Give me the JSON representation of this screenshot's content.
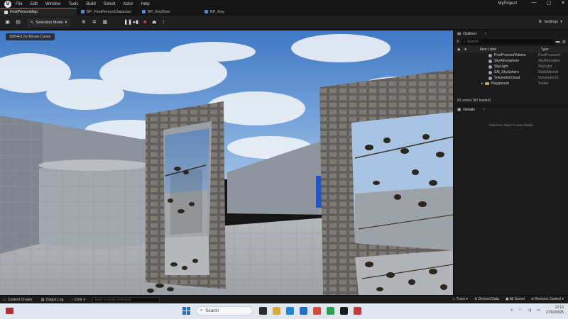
{
  "menubar": {
    "logo": "ue-logo",
    "items": [
      "File",
      "Edit",
      "Window",
      "Tools",
      "Build",
      "Select",
      "Actor",
      "Help"
    ],
    "project": "MyProject",
    "window_controls": [
      "—",
      "▢",
      "✕"
    ]
  },
  "tabs": [
    {
      "label": "FirstPersonMap",
      "active": true
    },
    {
      "label": "BP_FirstPersonCharacter",
      "active": false
    },
    {
      "label": "BP_KeyDoor",
      "active": false
    },
    {
      "label": "BP_Key",
      "active": false
    }
  ],
  "toolbar": {
    "mode_label": "Selection Mode",
    "settings_label": "Settings"
  },
  "viewport": {
    "hint": "Shift+F1 for Mouse Cursor"
  },
  "outliner": {
    "title": "Outliner",
    "search_placeholder": "Search...",
    "col_label": "Item Label",
    "col_type": "Type",
    "rows": [
      {
        "name": "PostProcessVolume",
        "type": "PostProcessV"
      },
      {
        "name": "SkyAtmosphere",
        "type": "SkyAtmosphe"
      },
      {
        "name": "SkyLight",
        "type": "SkyLight"
      },
      {
        "name": "SM_SkySphere",
        "type": "StaticMeshA"
      },
      {
        "name": "VolumetricCloud",
        "type": "VolumetricCl"
      }
    ],
    "folder_row": {
      "name": "Playground",
      "type": "Folder"
    },
    "actors_count": "82 actors (82 loaded)"
  },
  "details": {
    "title": "Details",
    "empty_message": "Select an object to view details."
  },
  "bottombar": {
    "content_drawer": "Content Drawer",
    "output_log": "Output Log",
    "cmd": "Cmd",
    "console_placeholder": "Enter Console Command",
    "trace": "Trace",
    "derived_data": "Derived Data",
    "all_saved": "All Saved",
    "revision_control": "Revision Control"
  },
  "taskbar": {
    "search_label": "Search",
    "time": "12:10",
    "date": "27/02/2025",
    "app_colors": [
      "#2c2c2c",
      "#d9a93b",
      "#1e88d6",
      "#1e6fd1",
      "#d84a3a",
      "#2a9d57",
      "#1a1a1a",
      "#c43b3b"
    ]
  },
  "colors": {
    "accent": "#3a7bd5",
    "folder": "#c9a25a"
  }
}
